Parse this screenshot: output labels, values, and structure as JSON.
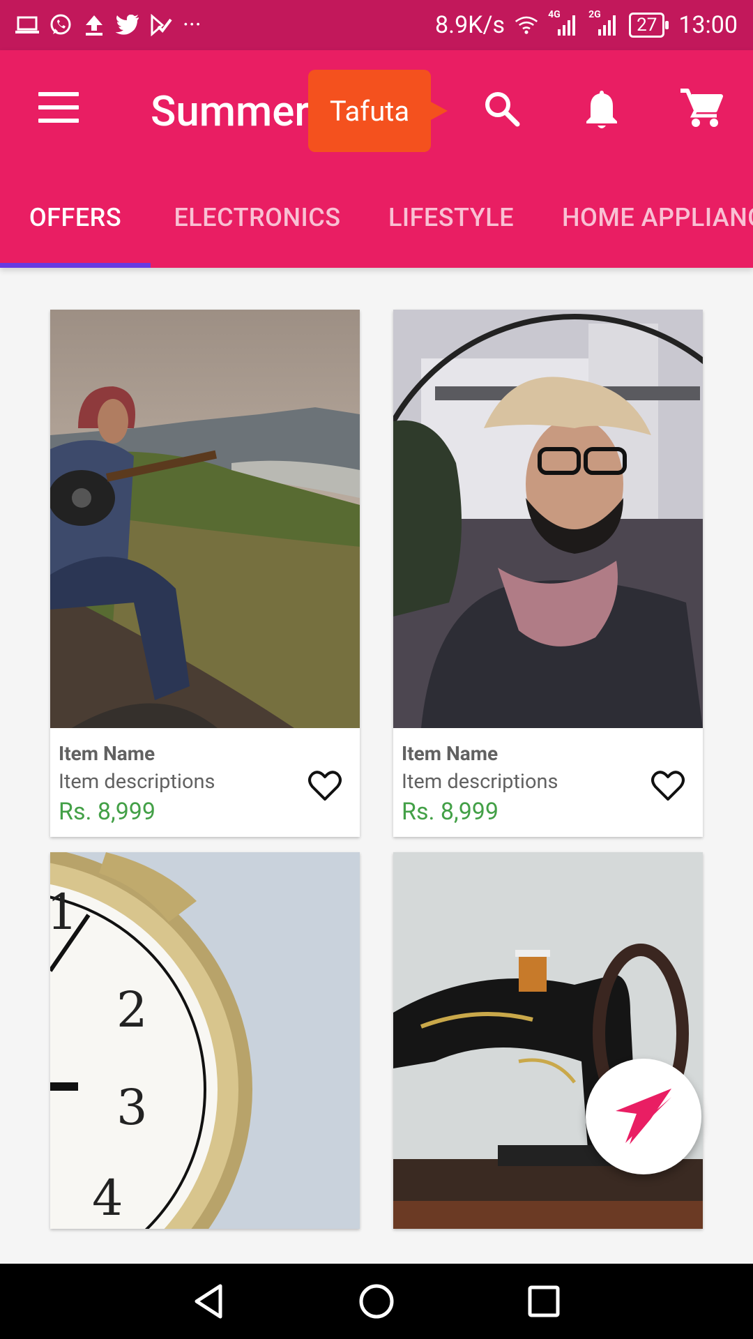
{
  "status_bar": {
    "net_speed": "8.9K/s",
    "net_4g": "4G",
    "net_2g": "2G",
    "battery": "27",
    "time": "13:00",
    "more": "···"
  },
  "app_bar": {
    "title": "Summer",
    "tooltip": "Tafuta"
  },
  "tabs": [
    {
      "label": "OFFERS",
      "active": true
    },
    {
      "label": "ELECTRONICS",
      "active": false
    },
    {
      "label": "LIFESTYLE",
      "active": false
    },
    {
      "label": "HOME APPLIANCES",
      "active": false
    }
  ],
  "products": [
    {
      "name": "Item Name",
      "description": "Item descriptions",
      "price": "Rs. 8,999",
      "image": "guitar-player-photo"
    },
    {
      "name": "Item Name",
      "description": "Item descriptions",
      "price": "Rs. 8,999",
      "image": "man-in-hat-photo"
    },
    {
      "name": "",
      "description": "",
      "price": "",
      "image": "alarm-clock-photo"
    },
    {
      "name": "",
      "description": "",
      "price": "",
      "image": "sewing-machine-photo"
    }
  ],
  "colors": {
    "status_bar": "#c2185b",
    "primary": "#e91e63",
    "tab_indicator": "#673ae2",
    "tooltip": "#f4511e",
    "price": "#43a047"
  }
}
